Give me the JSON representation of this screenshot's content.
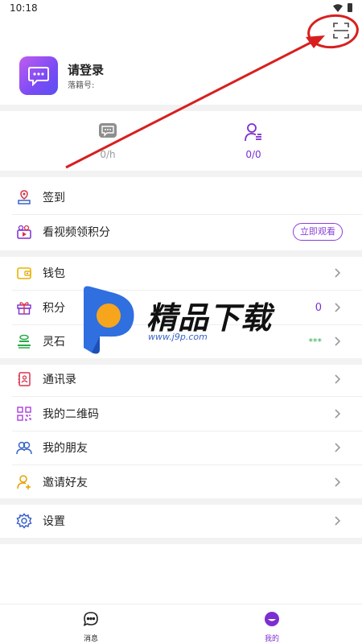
{
  "status": {
    "time": "10:18"
  },
  "profile": {
    "name": "请登录",
    "id_label": "落籍号:"
  },
  "stats": [
    {
      "value": "0/h",
      "color": "#9a9a9a"
    },
    {
      "value": "0/0",
      "color": "#7b2fd0"
    }
  ],
  "section1": [
    {
      "label": "签到"
    },
    {
      "label": "看视频领积分",
      "button": "立即观看"
    }
  ],
  "section2": [
    {
      "label": "钱包"
    },
    {
      "label": "积分",
      "value": "0"
    },
    {
      "label": "灵石",
      "value": "***"
    }
  ],
  "section3": [
    {
      "label": "通讯录"
    },
    {
      "label": "我的二维码"
    },
    {
      "label": "我的朋友"
    },
    {
      "label": "邀请好友"
    }
  ],
  "section4": [
    {
      "label": "设置"
    }
  ],
  "watermark": {
    "title": "精品下载",
    "url": "www.j9p.com"
  },
  "tabs": [
    {
      "label": "消息",
      "icon": "chat-icon"
    },
    {
      "label": "我的",
      "icon": "profile-icon"
    }
  ],
  "colors": {
    "accent": "#7b2fd0",
    "annotation": "#d81f1f",
    "section_gap": "#f2f2f2"
  }
}
